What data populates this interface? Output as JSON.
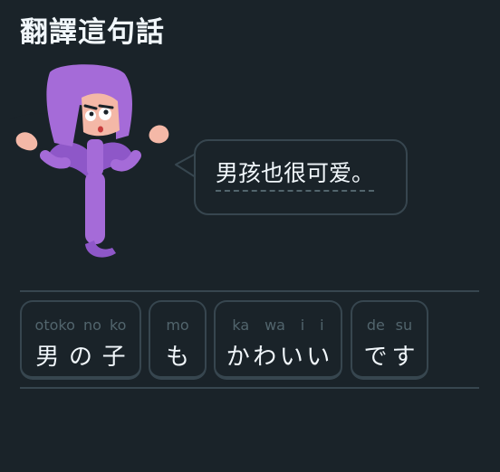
{
  "header": {
    "title": "翻譯這句話"
  },
  "prompt": {
    "sentence": "男孩也很可爱。"
  },
  "word_bank": {
    "tiles": [
      {
        "ruby": [
          "otoko",
          "no",
          "ko"
        ],
        "chars": [
          "男",
          "の",
          "子"
        ]
      },
      {
        "ruby": [
          "mo"
        ],
        "chars": [
          "も"
        ]
      },
      {
        "ruby": [
          "ka",
          "wa",
          "i",
          "i"
        ],
        "chars": [
          "か",
          "わ",
          "い",
          "い"
        ]
      },
      {
        "ruby": [
          "de",
          "su"
        ],
        "chars": [
          "で",
          "す"
        ]
      }
    ]
  },
  "colors": {
    "background": "#1a2329",
    "border": "#37464f",
    "text": "#f1f7fb",
    "ruby_text": "#52656d",
    "character_purple": "#a56bd8"
  }
}
